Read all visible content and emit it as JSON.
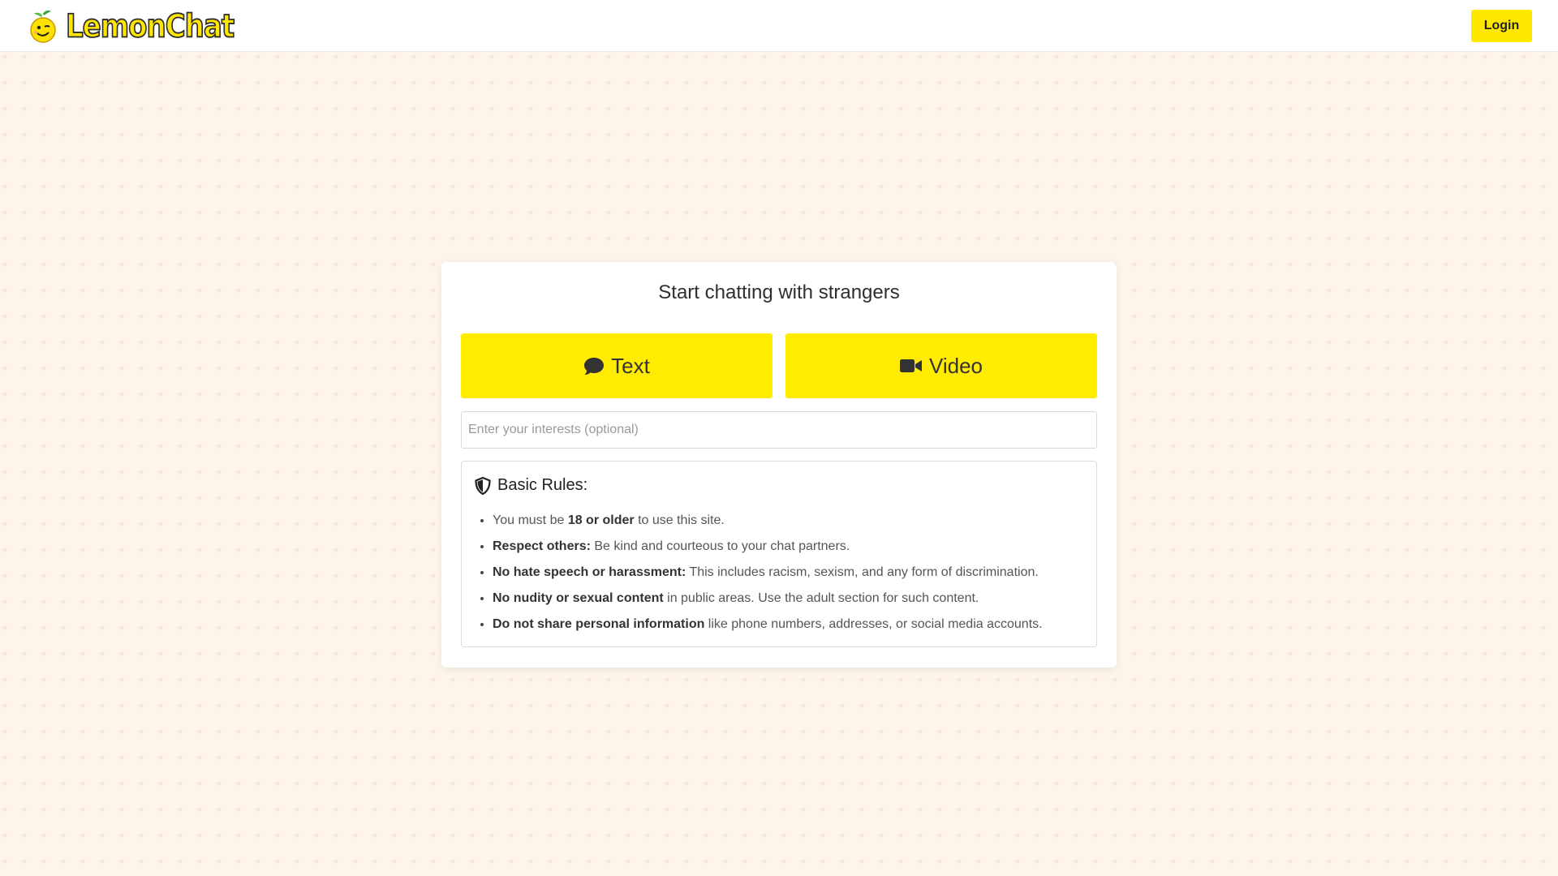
{
  "header": {
    "brand": "LemonChat",
    "login_label": "Login"
  },
  "main": {
    "title": "Start chatting with strangers",
    "text_button_label": "Text",
    "video_button_label": "Video",
    "interests_placeholder": "Enter your interests (optional)",
    "rules": {
      "heading": "Basic Rules:",
      "items": [
        {
          "bold": "",
          "pre": "You must be ",
          "mid_bold": "18 or older",
          "post": " to use this site."
        },
        {
          "bold": "Respect others:",
          "post": " Be kind and courteous to your chat partners."
        },
        {
          "bold": "No hate speech or harassment:",
          "post": " This includes racism, sexism, and any form of discrimination."
        },
        {
          "bold": "No nudity or sexual content",
          "post": " in public areas. Use the adult section for such content."
        },
        {
          "bold": "Do not share personal information",
          "post": " like phone numbers, addresses, or social media accounts."
        }
      ]
    }
  },
  "icons": {
    "logo": "lemon-mascot-icon",
    "text_button": "comment-icon",
    "video_button": "video-camera-icon",
    "rules": "shield-icon"
  },
  "colors": {
    "accent_yellow": "#ffec00",
    "page_background": "#fdf5ea"
  }
}
